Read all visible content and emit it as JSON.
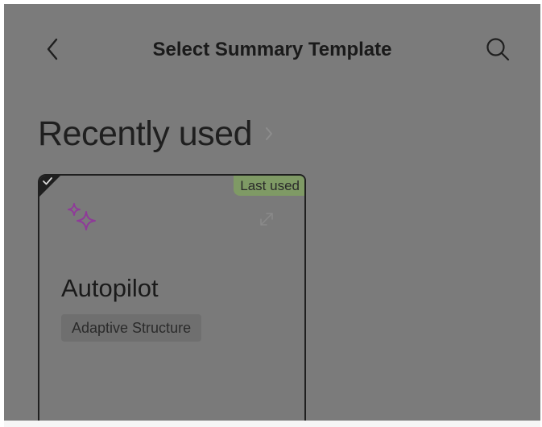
{
  "header": {
    "title": "Select Summary Template"
  },
  "icons": {
    "back": "chevron-left-icon",
    "search": "magnifier-icon",
    "section_more": "chevron-right-icon",
    "selected": "checkmark-icon",
    "template": "sparkles-icon",
    "expand": "expand-arrows-icon"
  },
  "recently_used": {
    "title": "Recently used",
    "cards": [
      {
        "badge": "Last used",
        "name": "Autopilot",
        "tag": "Adaptive Structure",
        "selected": true
      }
    ]
  },
  "colors": {
    "overlay": "#7b7b7b",
    "badge": "#7f9a65",
    "sparkle": "#8f3a99",
    "text": "#1a1a1a"
  }
}
